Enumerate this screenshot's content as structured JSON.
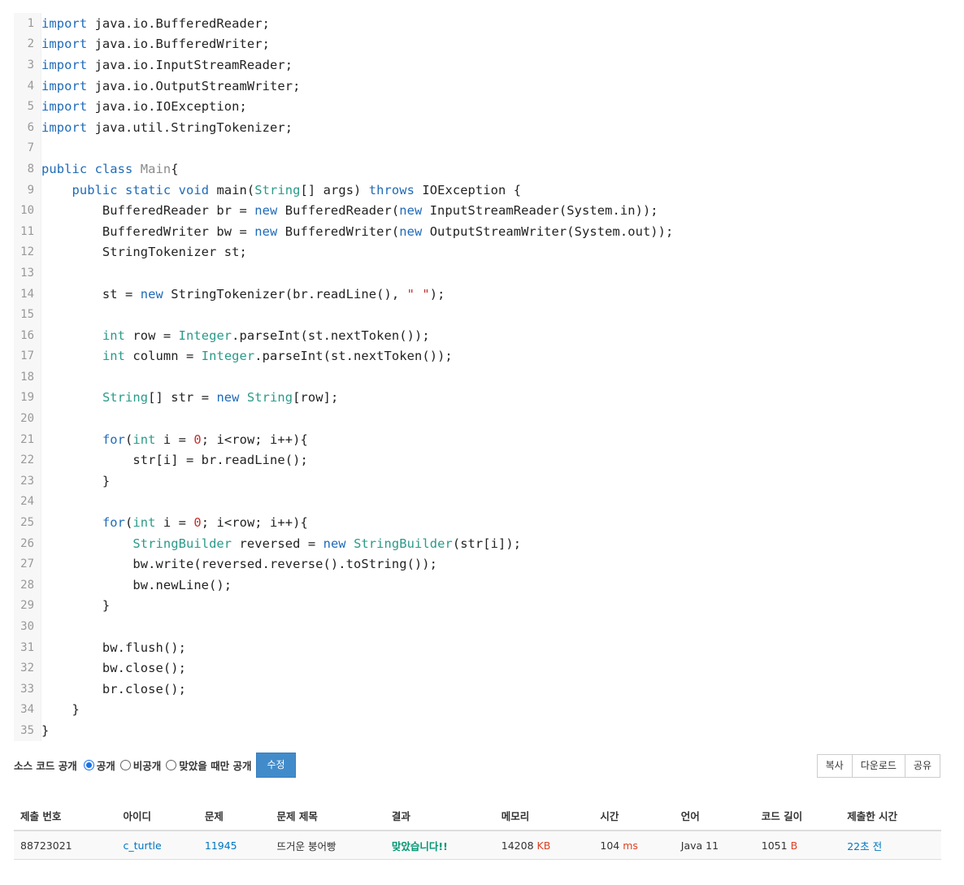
{
  "code_lines": [
    {
      "n": "1",
      "tokens": [
        {
          "t": "import",
          "c": "kw"
        },
        {
          "t": " java.io.BufferedReader;"
        }
      ]
    },
    {
      "n": "2",
      "tokens": [
        {
          "t": "import",
          "c": "kw"
        },
        {
          "t": " java.io.BufferedWriter;"
        }
      ]
    },
    {
      "n": "3",
      "tokens": [
        {
          "t": "import",
          "c": "kw"
        },
        {
          "t": " java.io.InputStreamReader;"
        }
      ]
    },
    {
      "n": "4",
      "tokens": [
        {
          "t": "import",
          "c": "kw"
        },
        {
          "t": " java.io.OutputStreamWriter;"
        }
      ]
    },
    {
      "n": "5",
      "tokens": [
        {
          "t": "import",
          "c": "kw"
        },
        {
          "t": " java.io.IOException;"
        }
      ]
    },
    {
      "n": "6",
      "tokens": [
        {
          "t": "import",
          "c": "kw"
        },
        {
          "t": " java.util.StringTokenizer;"
        }
      ]
    },
    {
      "n": "7",
      "tokens": []
    },
    {
      "n": "8",
      "tokens": [
        {
          "t": "public",
          "c": "kw"
        },
        {
          "t": " "
        },
        {
          "t": "class",
          "c": "kw"
        },
        {
          "t": " "
        },
        {
          "t": "Main",
          "c": "cl"
        },
        {
          "t": "{"
        }
      ]
    },
    {
      "n": "9",
      "tokens": [
        {
          "t": "    "
        },
        {
          "t": "public",
          "c": "kw"
        },
        {
          "t": " "
        },
        {
          "t": "static",
          "c": "kw"
        },
        {
          "t": " "
        },
        {
          "t": "void",
          "c": "kw"
        },
        {
          "t": " main("
        },
        {
          "t": "String",
          "c": "ty"
        },
        {
          "t": "[] args) "
        },
        {
          "t": "throws",
          "c": "kw"
        },
        {
          "t": " IOException {"
        }
      ]
    },
    {
      "n": "10",
      "tokens": [
        {
          "t": "        BufferedReader br = "
        },
        {
          "t": "new",
          "c": "kw"
        },
        {
          "t": " BufferedReader("
        },
        {
          "t": "new",
          "c": "kw"
        },
        {
          "t": " InputStreamReader(System.in));"
        }
      ]
    },
    {
      "n": "11",
      "tokens": [
        {
          "t": "        BufferedWriter bw = "
        },
        {
          "t": "new",
          "c": "kw"
        },
        {
          "t": " BufferedWriter("
        },
        {
          "t": "new",
          "c": "kw"
        },
        {
          "t": " OutputStreamWriter(System.out));"
        }
      ]
    },
    {
      "n": "12",
      "tokens": [
        {
          "t": "        StringTokenizer st;"
        }
      ]
    },
    {
      "n": "13",
      "tokens": []
    },
    {
      "n": "14",
      "tokens": [
        {
          "t": "        st = "
        },
        {
          "t": "new",
          "c": "kw"
        },
        {
          "t": " StringTokenizer(br.readLine(), "
        },
        {
          "t": "\" \"",
          "c": "str"
        },
        {
          "t": ");"
        }
      ]
    },
    {
      "n": "15",
      "tokens": []
    },
    {
      "n": "16",
      "tokens": [
        {
          "t": "        "
        },
        {
          "t": "int",
          "c": "ty"
        },
        {
          "t": " row = "
        },
        {
          "t": "Integer",
          "c": "ty"
        },
        {
          "t": ".parseInt(st.nextToken());"
        }
      ]
    },
    {
      "n": "17",
      "tokens": [
        {
          "t": "        "
        },
        {
          "t": "int",
          "c": "ty"
        },
        {
          "t": " column = "
        },
        {
          "t": "Integer",
          "c": "ty"
        },
        {
          "t": ".parseInt(st.nextToken());"
        }
      ]
    },
    {
      "n": "18",
      "tokens": []
    },
    {
      "n": "19",
      "tokens": [
        {
          "t": "        "
        },
        {
          "t": "String",
          "c": "ty"
        },
        {
          "t": "[] str = "
        },
        {
          "t": "new",
          "c": "kw"
        },
        {
          "t": " "
        },
        {
          "t": "String",
          "c": "ty"
        },
        {
          "t": "[row];"
        }
      ]
    },
    {
      "n": "20",
      "tokens": []
    },
    {
      "n": "21",
      "tokens": [
        {
          "t": "        "
        },
        {
          "t": "for",
          "c": "kw"
        },
        {
          "t": "("
        },
        {
          "t": "int",
          "c": "ty"
        },
        {
          "t": " i = "
        },
        {
          "t": "0",
          "c": "num"
        },
        {
          "t": "; i<row; i++){"
        }
      ]
    },
    {
      "n": "22",
      "tokens": [
        {
          "t": "            str[i] = br.readLine();"
        }
      ]
    },
    {
      "n": "23",
      "tokens": [
        {
          "t": "        }"
        }
      ]
    },
    {
      "n": "24",
      "tokens": []
    },
    {
      "n": "25",
      "tokens": [
        {
          "t": "        "
        },
        {
          "t": "for",
          "c": "kw"
        },
        {
          "t": "("
        },
        {
          "t": "int",
          "c": "ty"
        },
        {
          "t": " i = "
        },
        {
          "t": "0",
          "c": "num"
        },
        {
          "t": "; i<row; i++){"
        }
      ]
    },
    {
      "n": "26",
      "tokens": [
        {
          "t": "            "
        },
        {
          "t": "StringBuilder",
          "c": "ty"
        },
        {
          "t": " reversed = "
        },
        {
          "t": "new",
          "c": "kw"
        },
        {
          "t": " "
        },
        {
          "t": "StringBuilder",
          "c": "ty"
        },
        {
          "t": "(str[i]);"
        }
      ]
    },
    {
      "n": "27",
      "tokens": [
        {
          "t": "            bw.write(reversed.reverse().toString());"
        }
      ]
    },
    {
      "n": "28",
      "tokens": [
        {
          "t": "            bw.newLine();"
        }
      ]
    },
    {
      "n": "29",
      "tokens": [
        {
          "t": "        }"
        }
      ]
    },
    {
      "n": "30",
      "tokens": []
    },
    {
      "n": "31",
      "tokens": [
        {
          "t": "        bw.flush();"
        }
      ]
    },
    {
      "n": "32",
      "tokens": [
        {
          "t": "        bw.close();"
        }
      ]
    },
    {
      "n": "33",
      "tokens": [
        {
          "t": "        br.close();"
        }
      ]
    },
    {
      "n": "34",
      "tokens": [
        {
          "t": "    }"
        }
      ]
    },
    {
      "n": "35",
      "tokens": [
        {
          "t": "}"
        }
      ]
    }
  ],
  "visibility": {
    "label": "소스 코드 공개",
    "options": [
      {
        "label": "공개",
        "checked": true
      },
      {
        "label": "비공개",
        "checked": false
      },
      {
        "label": "맞았을 때만 공개",
        "checked": false
      }
    ],
    "edit_label": "수정"
  },
  "actions": {
    "copy": "복사",
    "download": "다운로드",
    "share": "공유"
  },
  "table": {
    "headers": [
      "제출 번호",
      "아이디",
      "문제",
      "문제 제목",
      "결과",
      "메모리",
      "시간",
      "언어",
      "코드 길이",
      "제출한 시간"
    ],
    "row": {
      "submission_id": "88723021",
      "user_id": "c_turtle",
      "problem": "11945",
      "problem_title": "뜨거운 붕어빵",
      "result": "맞았습니다!!",
      "memory": "14208",
      "memory_unit": "KB",
      "time": "104",
      "time_unit": "ms",
      "language": "Java 11",
      "code_length": "1051",
      "code_length_unit": "B",
      "submitted": "22초 전"
    }
  },
  "colors": {
    "keyword": "#1f6ab8",
    "type": "#2a9a8a",
    "accepted": "#009874",
    "unit": "#dd4124",
    "link": "#0076c0",
    "edit_button": "#428bca"
  }
}
